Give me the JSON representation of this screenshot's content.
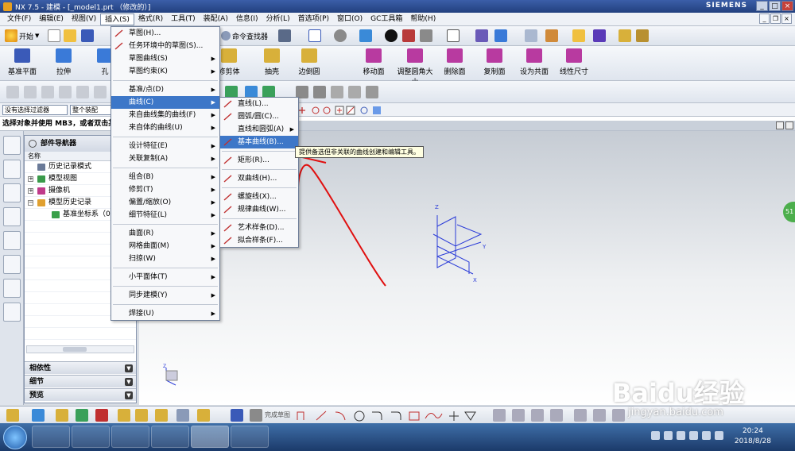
{
  "window": {
    "title": "NX 7.5 - 建模 - [_model1.prt （修改的）]",
    "brand": "SIEMENS"
  },
  "menubar": {
    "items": [
      "文件(F)",
      "编辑(E)",
      "视图(V)",
      "插入(S)",
      "格式(R)",
      "工具(T)",
      "装配(A)",
      "信息(I)",
      "分析(L)",
      "首选项(P)",
      "窗口(O)",
      "GC工具箱",
      "帮助(H)"
    ],
    "active_index": 3
  },
  "toolbar1": {
    "start_label": "开始",
    "command_finder_label": "命令查找器"
  },
  "toolbar2": {
    "items": [
      "基准平面",
      "拉伸",
      "孔",
      "修剪体",
      "抽壳",
      "边倒圆",
      "移动面",
      "调整圆角大小",
      "删除面",
      "复制面",
      "设为共面",
      "线性尺寸"
    ]
  },
  "selection": {
    "filter_value": "没有选择过滤器",
    "scope_value": "整个装配"
  },
  "cue_line": "选择对象并使用 MB3，或者双击某一对象",
  "navigator": {
    "title": "部件导航器",
    "column": "名称",
    "rows": [
      {
        "label": "历史记录模式",
        "indent": 0
      },
      {
        "label": "模型视图",
        "indent": 0
      },
      {
        "label": "摄像机",
        "indent": 0
      },
      {
        "label": "模型历史记录",
        "indent": 0
      },
      {
        "label": "基准坐标系（0）",
        "indent": 1
      }
    ],
    "panels": [
      "相依性",
      "细节",
      "预览"
    ]
  },
  "insert_menu": {
    "items": [
      {
        "label": "草图(H)...",
        "icon": "sketch-icon",
        "submenu": false
      },
      {
        "label": "任务环境中的草图(S)...",
        "icon": "sketch-task-icon",
        "submenu": false
      },
      {
        "label": "草图曲线(S)",
        "submenu": true
      },
      {
        "label": "草图约束(K)",
        "submenu": true
      },
      {
        "sep": true
      },
      {
        "label": "基准/点(D)",
        "submenu": true
      },
      {
        "label": "曲线(C)",
        "submenu": true,
        "highlight": true
      },
      {
        "label": "来自曲线集的曲线(F)",
        "submenu": true
      },
      {
        "label": "来自体的曲线(U)",
        "submenu": true
      },
      {
        "sep": true
      },
      {
        "label": "设计特征(E)",
        "submenu": true
      },
      {
        "label": "关联复制(A)",
        "submenu": true
      },
      {
        "sep": true
      },
      {
        "label": "组合(B)",
        "submenu": true
      },
      {
        "label": "修剪(T)",
        "submenu": true
      },
      {
        "label": "偏置/缩放(O)",
        "submenu": true
      },
      {
        "label": "细节特征(L)",
        "submenu": true
      },
      {
        "sep": true
      },
      {
        "label": "曲面(R)",
        "submenu": true
      },
      {
        "label": "网格曲面(M)",
        "submenu": true
      },
      {
        "label": "扫掠(W)",
        "submenu": true
      },
      {
        "sep": true
      },
      {
        "label": "小平面体(T)",
        "submenu": true
      },
      {
        "sep": true
      },
      {
        "label": "同步建模(Y)",
        "submenu": true
      },
      {
        "sep": true
      },
      {
        "label": "焊接(U)",
        "submenu": true
      }
    ]
  },
  "curve_menu": {
    "items": [
      {
        "label": "直线(L)...",
        "icon": "line-icon",
        "submenu": false
      },
      {
        "label": "圆弧/圆(C)...",
        "icon": "arc-icon",
        "submenu": false
      },
      {
        "label": "直线和圆弧(A)",
        "submenu": true
      },
      {
        "label": "基本曲线(B)...",
        "icon": "basic-curve-icon",
        "submenu": false,
        "highlight": true
      },
      {
        "sep": true
      },
      {
        "label": "矩形(R)...",
        "icon": "rectangle-icon",
        "submenu": false
      },
      {
        "sep": true
      },
      {
        "label": "双曲线(H)...",
        "icon": "hyperbola-icon",
        "submenu": false
      },
      {
        "sep": true
      },
      {
        "label": "螺旋线(X)...",
        "icon": "helix-icon",
        "submenu": false
      },
      {
        "label": "规律曲线(W)...",
        "icon": "law-curve-icon",
        "submenu": false
      },
      {
        "sep": true
      },
      {
        "label": "艺术样条(D)...",
        "icon": "studio-spline-icon",
        "submenu": false
      },
      {
        "label": "拟合样条(F)...",
        "icon": "fit-spline-icon",
        "submenu": false
      }
    ]
  },
  "tooltip": "提供备选但非关联的曲线创建和编辑工具。",
  "bottom_toolbar": {
    "finish_sketch": "完成草图"
  },
  "csys": {
    "x": "X",
    "y": "Y",
    "z": "Z"
  },
  "taskbar": {
    "time": "20:24",
    "date": "2018/8/28"
  },
  "watermark": {
    "brand": "Baidu经验",
    "url": "jingyan.baidu.com"
  },
  "side_badge": "51",
  "colors": {
    "highlight": "#3d77c8",
    "annotation": "#e01010",
    "csys": "#2a3bd8"
  }
}
